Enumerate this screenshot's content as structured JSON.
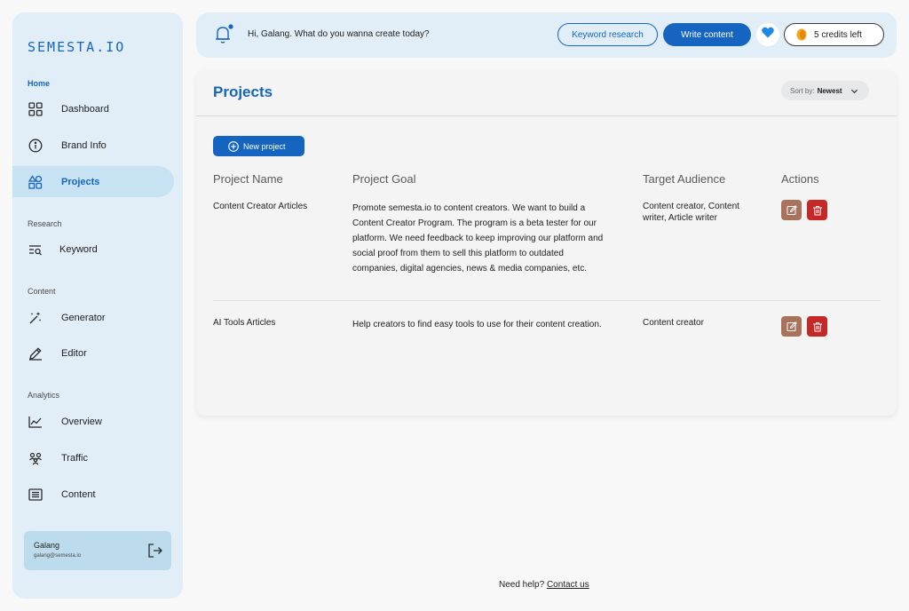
{
  "brand": {
    "logo": "SEMESTA.IO"
  },
  "sidebar": {
    "sections": {
      "home": "Home",
      "research": "Research",
      "content": "Content",
      "analytics": "Analytics"
    },
    "items": {
      "dashboard": "Dashboard",
      "brand_info": "Brand Info",
      "projects": "Projects",
      "keyword": "Keyword",
      "generator": "Generator",
      "editor": "Editor",
      "overview": "Overview",
      "traffic": "Traffic",
      "content": "Content"
    },
    "active": "projects",
    "user": {
      "name": "Galang",
      "email": "galang@semesta.io"
    }
  },
  "topbar": {
    "greeting": "Hi, Galang. What do you wanna create today?",
    "keyword_research": "Keyword research",
    "write_content": "Write content",
    "credits": "5 credits left"
  },
  "main": {
    "title": "Projects",
    "sort": {
      "label": "Sort by:",
      "value": "Newest"
    },
    "new_project": "New project",
    "columns": [
      "Project Name",
      "Project Goal",
      "Target Audience",
      "Actions"
    ],
    "rows": [
      {
        "name": "Content Creator Articles",
        "goal": "Promote semesta.io to content creators. We want to build a Content Creator Program. The program is a beta tester for our platform. We need feedback to keep improving our platform and social proof from them to sell this platform to outdated companies, digital agencies, news & media companies, etc.",
        "audience": "Content creator, Content writer, Article writer"
      },
      {
        "name": "AI Tools Articles",
        "goal": "Help creators to find easy tools to use for their content creation.",
        "audience": "Content creator"
      }
    ]
  },
  "footer": {
    "text": "Need help?",
    "link": "Contact us"
  },
  "colors": {
    "accent": "#1565c0",
    "sidebar_bg": "#e1eef8",
    "edit": "#a8735a",
    "delete": "#c62828"
  }
}
